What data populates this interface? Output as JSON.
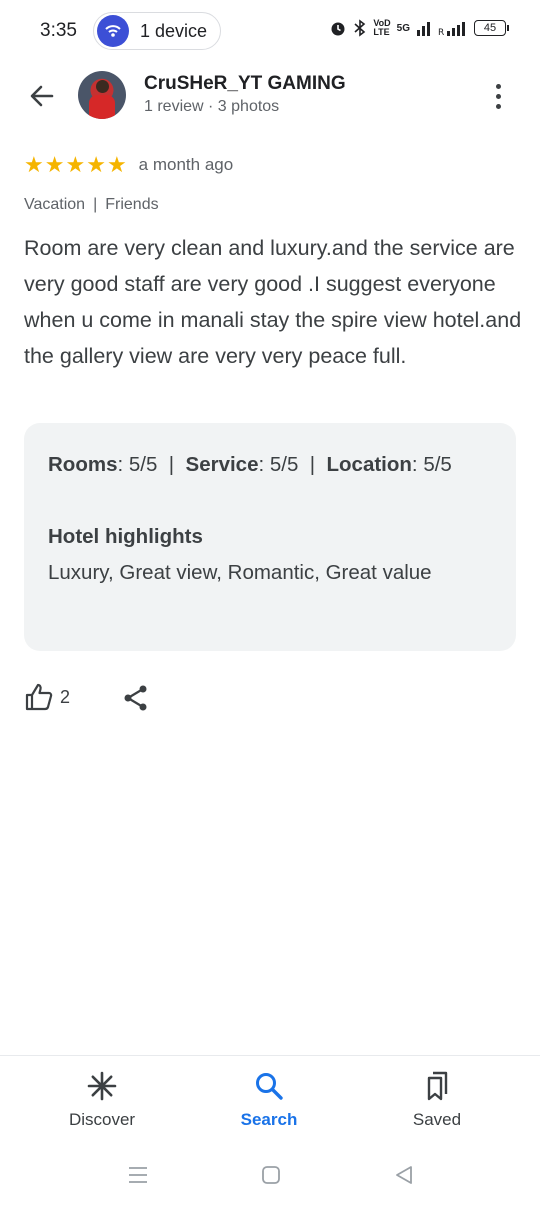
{
  "status_bar": {
    "time": "3:35",
    "device_label": "1 device",
    "battery": "45",
    "network_label": "5G"
  },
  "header": {
    "user_name": "CruSHeR_YT GAMING",
    "user_meta": "1 review · 3 photos"
  },
  "review": {
    "rating": 5,
    "stars": [
      "★",
      "★",
      "★",
      "★",
      "★"
    ],
    "date": "a month ago",
    "trip_type": "Vacation",
    "trip_with": "Friends",
    "text": "Room are very clean and luxury.and the service are very good staff are very good .I suggest everyone when u come in manali stay the spire view hotel.and the gallery view are very very peace full."
  },
  "ratings_card": {
    "rooms_label": "Rooms",
    "rooms_value": ": 5/5",
    "service_label": "Service",
    "service_value": ": 5/5",
    "location_label": "Location",
    "location_value": ": 5/5",
    "separator": "|",
    "highlights_title": "Hotel highlights",
    "highlights_value": "Luxury, Great view, Romantic, Great value"
  },
  "actions": {
    "like_count": "2"
  },
  "bottom_nav": {
    "items": [
      {
        "label": "Discover",
        "icon": "asterisk-icon"
      },
      {
        "label": "Search",
        "icon": "search-icon"
      },
      {
        "label": "Saved",
        "icon": "bookmarks-icon"
      }
    ],
    "active_color": "#1a73e8"
  },
  "colors": {
    "star": "#f5b400",
    "card_bg": "#f1f3f4",
    "accent": "#1a73e8"
  }
}
